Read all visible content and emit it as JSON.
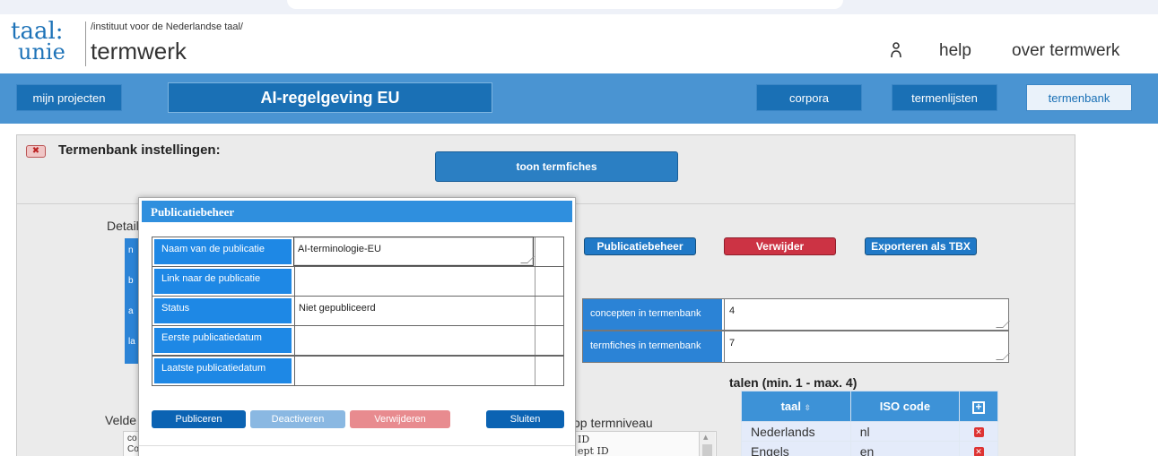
{
  "header": {
    "logo_top": "taal:",
    "logo_bottom": "unie",
    "institute": "/instituut voor de Nederlandse taal/",
    "app_name": "termwerk",
    "user_icon": "person-icon",
    "help": "help",
    "over": "over termwerk"
  },
  "nav": {
    "projects": "mijn projecten",
    "project_title": "AI-regelgeving EU",
    "corpora": "corpora",
    "termenlijsten": "termenlijsten",
    "termenbank": "termenbank"
  },
  "panel": {
    "title": "Termenbank instellingen:",
    "toon_termfiches": "toon termfiches",
    "detail_label": "Detail",
    "detail_col_letters": [
      "n",
      "b",
      "a",
      "la"
    ],
    "velde_label": "Velde",
    "velde_items": [
      "co",
      "Co"
    ]
  },
  "actions": {
    "publicatiebeheer": "Publicatiebeheer",
    "verwijder": "Verwijder",
    "exporteren": "Exporteren als TBX"
  },
  "stats": [
    {
      "label": "concepten in termenbank",
      "value": "4"
    },
    {
      "label": "termfiches in termenbank",
      "value": "7"
    }
  ],
  "talen": {
    "title": "talen (min. 1 - max. 4)",
    "col_taal": "taal",
    "col_iso": "ISO code",
    "rows": [
      {
        "taal": "Nederlands",
        "iso": "nl"
      },
      {
        "taal": "Engels",
        "iso": "en"
      }
    ]
  },
  "termniveau": {
    "label": "op termniveau",
    "items": [
      "ID",
      "ept ID"
    ]
  },
  "modal": {
    "title": "Publicatiebeheer",
    "rows": [
      {
        "label": "Naam van de publicatie",
        "value": "AI-terminologie-EU"
      },
      {
        "label": "Link naar de publicatie",
        "value": ""
      },
      {
        "label": "Status",
        "value": "Niet gepubliceerd"
      },
      {
        "label": "Eerste publicatiedatum",
        "value": ""
      },
      {
        "label": "Laatste publicatiedatum",
        "value": ""
      }
    ],
    "buttons": {
      "publiceren": "Publiceren",
      "deactiveren": "Deactiveren",
      "verwijderen": "Verwijderen",
      "sluiten": "Sluiten"
    }
  },
  "colors": {
    "brand_blue": "#1a70b5",
    "navbar": "#4a94d2",
    "danger": "#cc3344"
  }
}
